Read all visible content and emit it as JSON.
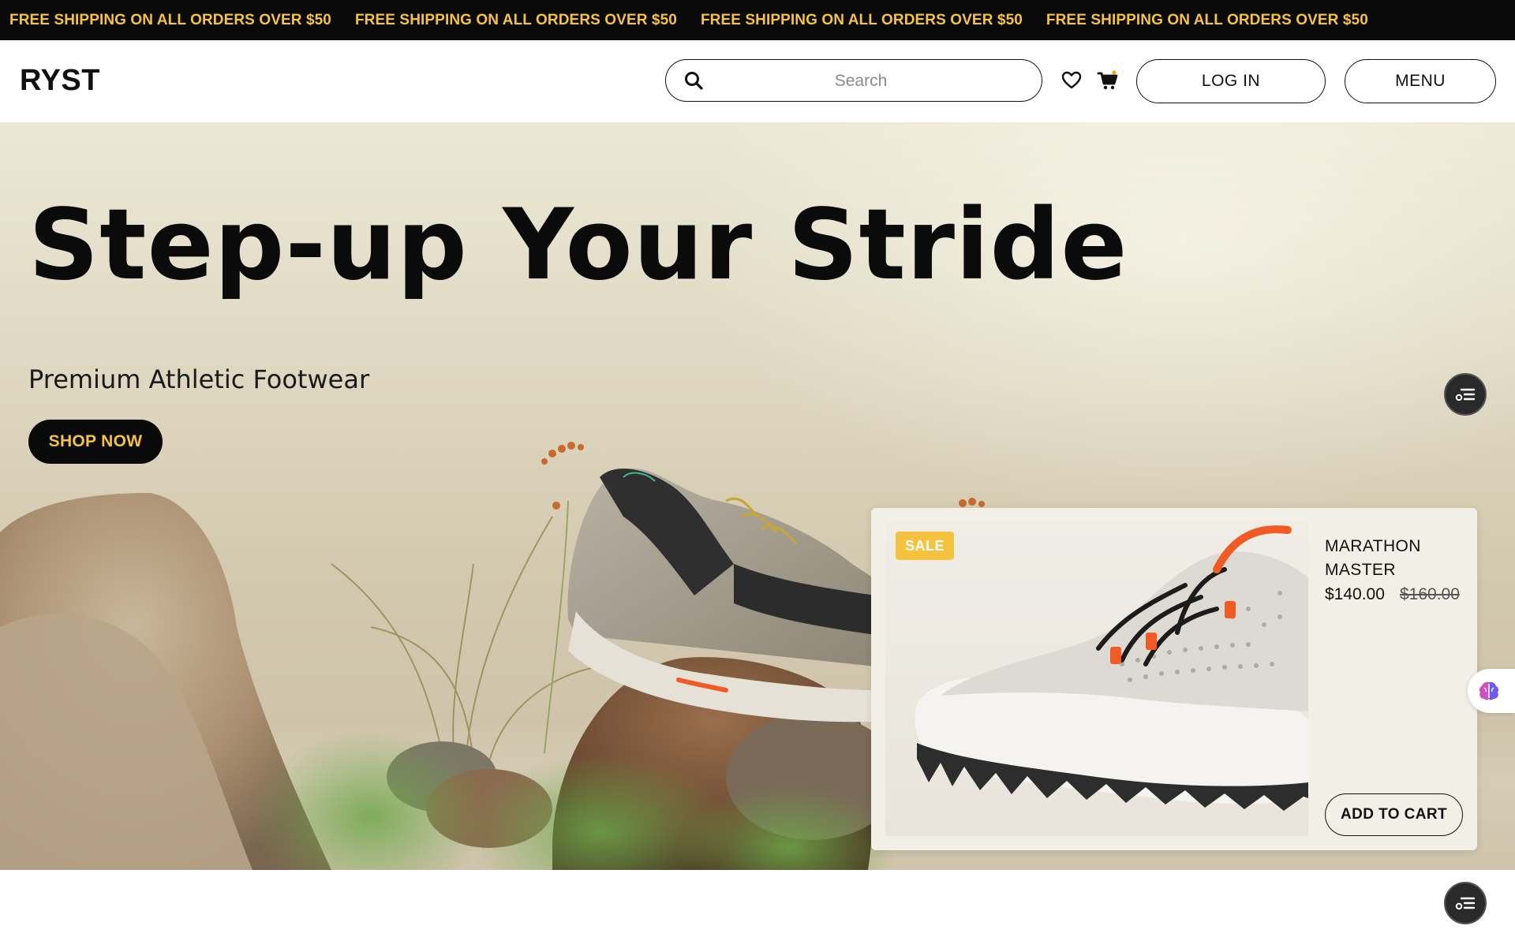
{
  "announcement": {
    "items": [
      "FREE SHIPPING ON ALL ORDERS OVER $50",
      "FREE SHIPPING ON ALL ORDERS OVER $50",
      "FREE SHIPPING ON ALL ORDERS OVER $50",
      "FREE SHIPPING ON ALL ORDERS OVER $50"
    ],
    "color": "#f5c244"
  },
  "header": {
    "logo": "RYST",
    "search_placeholder": "Search",
    "login_label": "LOG IN",
    "menu_label": "MENU"
  },
  "hero": {
    "title": "Step-up Your Stride",
    "subtitle": "Premium Athletic Footwear",
    "cta_label": "SHOP NOW"
  },
  "product_card": {
    "badge": "SALE",
    "name": "MARATHON MASTER",
    "price": "$140.00",
    "original_price": "$160.00",
    "add_to_cart_label": "ADD TO CART"
  },
  "colors": {
    "accent": "#f5c244",
    "dark": "#0a0a0a",
    "sale": "#f5c23d",
    "shoe_accent": "#f05a24"
  },
  "icons": [
    "search-icon",
    "heart-icon",
    "cart-icon",
    "list-icon",
    "brain-icon"
  ]
}
